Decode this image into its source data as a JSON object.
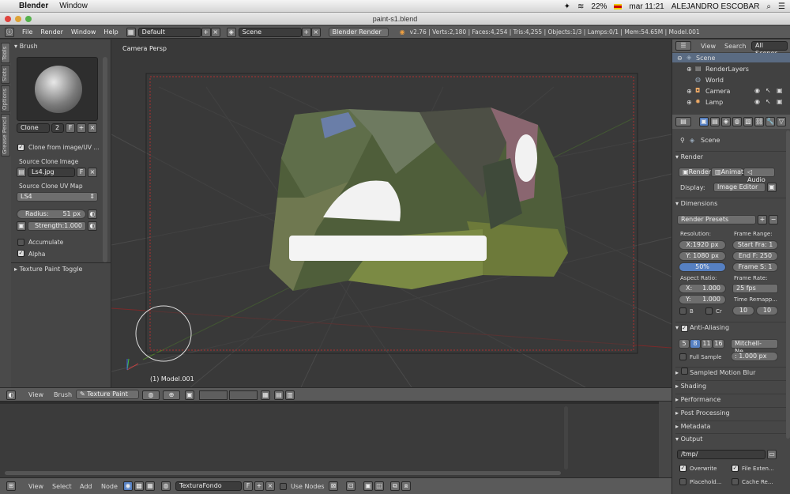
{
  "mac_menu": {
    "app": "Blender",
    "window": "Window",
    "battery": "22%",
    "clock": "mar 11:21",
    "user": "ALEJANDRO ESCOBAR"
  },
  "window": {
    "title": "paint-s1.blend"
  },
  "header": {
    "menus": [
      "File",
      "Render",
      "Window",
      "Help"
    ],
    "screen": "Default",
    "scene": "Scene",
    "engine": "Blender Render",
    "stats": "v2.76 | Verts:2,180 | Faces:4,254 | Tris:4,255 | Objects:1/3 | Lamps:0/1 | Mem:54.65M | Model.001"
  },
  "left_tabs": [
    "Tools",
    "Slots",
    "Options",
    "Grease Pencil"
  ],
  "tool_panel": {
    "brush_title": "Brush",
    "brush_name": "Clone",
    "brush_users": "2",
    "f_label": "F",
    "clone_from_uv": "Clone from image/UV ...",
    "source_clone_image_label": "Source Clone Image",
    "source_image": "Ls4.jpg",
    "source_uv_label": "Source Clone UV Map",
    "source_uv": "LS4",
    "radius_label": "Radius:",
    "radius_value": "51 px",
    "strength_label": "Strength:",
    "strength_value": "1.000",
    "accumulate": "Accumulate",
    "alpha": "Alpha",
    "texture_paint_toggle": "Texture Paint Toggle"
  },
  "viewport": {
    "label": "Camera Persp",
    "object": "(1) Model.001"
  },
  "view_header": {
    "view": "View",
    "brush": "Brush",
    "mode": "Texture Paint"
  },
  "node_header": {
    "view": "View",
    "select": "Select",
    "add": "Add",
    "node": "Node",
    "texture": "TexturaFondo",
    "f": "F",
    "use_nodes": "Use Nodes"
  },
  "outliner": {
    "view": "View",
    "search": "Search",
    "filter": "All Scenes",
    "items": [
      {
        "label": "Scene"
      },
      {
        "label": "RenderLayers"
      },
      {
        "label": "World"
      },
      {
        "label": "Camera"
      },
      {
        "label": "Lamp"
      }
    ]
  },
  "properties": {
    "scene_label": "Scene",
    "render_section": "Render",
    "render_btn": "Render",
    "anim_btn": "Animati",
    "audio_btn": "Audio",
    "display_label": "Display:",
    "display_value": "Image Editor",
    "dimensions": "Dimensions",
    "render_presets": "Render Presets",
    "resolution": "Resolution:",
    "res_x": "X:1920 px",
    "res_y": "Y: 1080 px",
    "res_pct": "50%",
    "frame_range": "Frame Range:",
    "start": "Start Fra: 1",
    "end": "End F: 250",
    "step": "Frame S: 1",
    "aspect_ratio": "Aspect Ratio:",
    "asp_x": "X:",
    "asp_x_val": "1.000",
    "asp_y": "Y:",
    "asp_y_val": "1.000",
    "frame_rate": "Frame Rate:",
    "fps": "25 fps",
    "time_remap": "Time Remapp...",
    "remap_a": "10",
    "remap_b": "10",
    "b_label": "B",
    "cr_label": "Cr",
    "anti_aliasing": "Anti-Aliasing",
    "aa_samples": [
      "5",
      "8",
      "11",
      "16"
    ],
    "aa_filter": "Mitchell-Ne...",
    "full_sample": "Full Sample",
    "filter_size": ": 1.000 px",
    "motion_blur": "Sampled Motion Blur",
    "shading": "Shading",
    "performance": "Performance",
    "post_processing": "Post Processing",
    "metadata": "Metadata",
    "output": "Output",
    "output_path": "/tmp/",
    "overwrite": "Overwrite",
    "file_ext": "File Exten...",
    "placeholders": "Placehold...",
    "cache_result": "Cache Re..."
  }
}
